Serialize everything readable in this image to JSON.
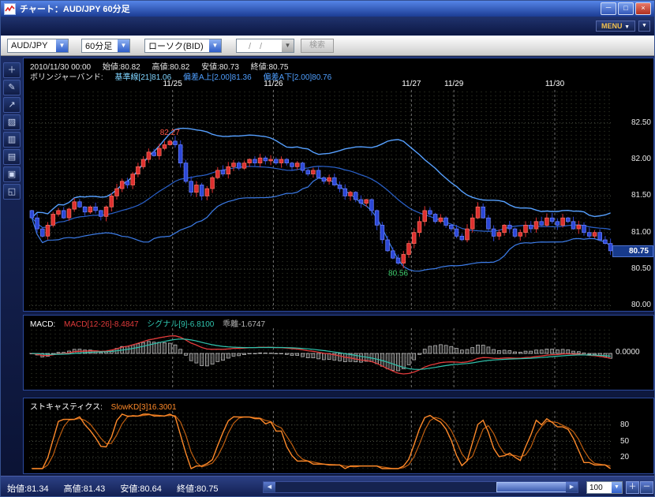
{
  "window": {
    "title": "チャート：AUD/JPY 60分足"
  },
  "titlebar": {
    "minimize": "－",
    "maximize": "□",
    "close": "×"
  },
  "menubar": {
    "menu_label": "MENU",
    "menu_arrow": "▼",
    "extra_arrow": "▼"
  },
  "ui": {
    "arrow_down": "▼",
    "arrow_left": "◀",
    "arrow_right": "▶"
  },
  "toolbar": {
    "pair_value": "AUD/JPY",
    "period_value": "60分足",
    "type_value": "ローソク(BID)",
    "date_value": "　/　/",
    "search_label": "検索"
  },
  "quote": {
    "datetime": "2010/11/30 00:00",
    "open": "始値:80.82",
    "high": "高値:80.82",
    "low": "安値:80.73",
    "close": "終値:80.75"
  },
  "boll": {
    "label": "ボリンジャーバンド:",
    "basis": "基準線[21]81.06",
    "upper": "偏差A上[2.00]81.36",
    "lower": "偏差A下[2.00]80.76"
  },
  "macd_header": {
    "label": "MACD:",
    "macd": "MACD[12-26]-8.4847",
    "signal": "シグナル[9]-6.8100",
    "diff": "乖離-1.6747"
  },
  "stoch_header": {
    "label": "ストキャスティクス:",
    "value": "SlowKD[3]16.3001"
  },
  "bottom": {
    "open": "始値:81.34",
    "high": "高値:81.43",
    "low": "安値:80.64",
    "close": "終値:80.75",
    "zoom_value": "100",
    "zoom_in": "＋",
    "zoom_out": "－"
  },
  "left_toolbar": [
    {
      "name": "crosshair-tool-icon",
      "glyph": "＋"
    },
    {
      "name": "pencil-tool-icon",
      "glyph": "✎"
    },
    {
      "name": "trendline-tool-icon",
      "glyph": "↗"
    },
    {
      "name": "chart-type-tool-icon",
      "glyph": "▨"
    },
    {
      "name": "grid-tool-icon",
      "glyph": "▥"
    },
    {
      "name": "book-tool-icon",
      "glyph": "▤"
    },
    {
      "name": "print-tool-icon",
      "glyph": "▣"
    },
    {
      "name": "layout-tool-icon",
      "glyph": "◱"
    }
  ],
  "colors": {
    "up": "#dd2f2f",
    "up_edge": "#ff7766",
    "down": "#2b47d6",
    "down_edge": "#6f86ff",
    "band_upper": "#56a0ff",
    "band_mid": "#2a62cc",
    "band_lower": "#3c7ce8",
    "macd_line": "#e23b3b",
    "signal_line": "#2fc4ae",
    "hist_fill": "rgba(215,215,215,0.22)",
    "hist_edge": "#c9c9c9",
    "stoch_k": "#ff8a2a",
    "stoch_d": "#c05f10",
    "grid": "#4a4f45",
    "dategrid": "#6d6d6d"
  },
  "chart_data": {
    "type": "candlestick",
    "pair": "AUD/JPY",
    "interval": "60min",
    "y_axis_labels": [
      "82.50",
      "82.00",
      "81.50",
      "81.00",
      "80.50",
      "80.00"
    ],
    "y_min": 79.95,
    "y_max": 82.95,
    "current_price": "80.75",
    "current_price_value": 80.75,
    "first_open": 81.3,
    "high_marker": {
      "index": 26,
      "value": 82.27,
      "label": "82.27",
      "color": "#ff5544"
    },
    "low_marker": {
      "index": 69,
      "value": 80.56,
      "label": "80.56",
      "color": "#3fd06f"
    },
    "dates": [
      {
        "label": "11/25",
        "index": 27
      },
      {
        "label": "11/26",
        "index": 46
      },
      {
        "label": "11/27",
        "index": 72
      },
      {
        "label": "11/29",
        "index": 80
      },
      {
        "label": "11/30",
        "index": 99
      }
    ],
    "closes": [
      81.2,
      81.05,
      80.95,
      81.1,
      81.25,
      81.3,
      81.2,
      81.32,
      81.42,
      81.35,
      81.28,
      81.35,
      81.3,
      81.22,
      81.35,
      81.5,
      81.6,
      81.7,
      81.65,
      81.8,
      81.9,
      82.0,
      82.1,
      82.05,
      82.15,
      82.2,
      82.25,
      82.2,
      81.95,
      81.7,
      81.55,
      81.65,
      81.5,
      81.6,
      81.75,
      81.85,
      81.8,
      81.9,
      81.95,
      81.88,
      81.95,
      82.0,
      81.95,
      82.02,
      81.98,
      82.0,
      81.95,
      82.0,
      81.95,
      81.9,
      81.95,
      81.85,
      81.8,
      81.85,
      81.75,
      81.7,
      81.75,
      81.65,
      81.6,
      81.5,
      81.55,
      81.45,
      81.4,
      81.45,
      81.3,
      81.1,
      80.9,
      80.75,
      80.65,
      80.58,
      80.7,
      80.85,
      81.0,
      81.15,
      81.3,
      81.25,
      81.15,
      81.2,
      81.1,
      81.05,
      80.95,
      80.9,
      81.05,
      81.2,
      81.35,
      81.2,
      81.05,
      80.95,
      81.0,
      81.1,
      81.05,
      80.95,
      81.0,
      81.1,
      81.05,
      81.15,
      81.1,
      81.2,
      81.15,
      81.1,
      81.2,
      81.15,
      81.05,
      81.1,
      81.0,
      80.95,
      81.0,
      80.9,
      80.85,
      80.75
    ],
    "bollinger": {
      "period": 21,
      "mult": 2
    },
    "macd": {
      "fast": 12,
      "slow": 26,
      "signal": 9,
      "zero_label": "0.0000"
    },
    "stochastic": {
      "labels": [
        "80",
        "50",
        "20"
      ],
      "levels": [
        80,
        50,
        20
      ]
    }
  }
}
